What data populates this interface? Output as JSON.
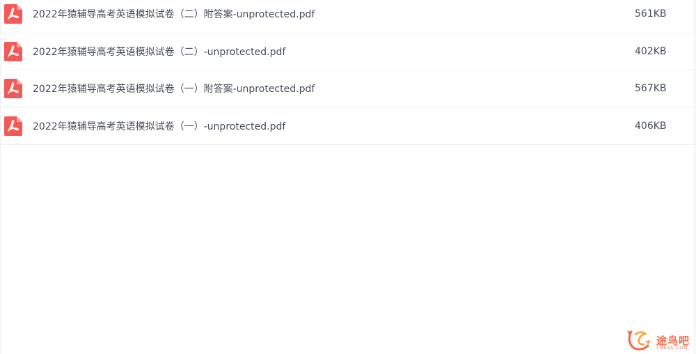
{
  "files": [
    {
      "name": "2022年猿辅导高考英语模拟试卷（二）附答案-unprotected.pdf",
      "size": "561KB",
      "icon": "pdf-icon"
    },
    {
      "name": "2022年猿辅导高考英语模拟试卷（二）-unprotected.pdf",
      "size": "402KB",
      "icon": "pdf-icon"
    },
    {
      "name": "2022年猿辅导高考英语模拟试卷（一）附答案-unprotected.pdf",
      "size": "567KB",
      "icon": "pdf-icon"
    },
    {
      "name": "2022年猿辅导高考英语模拟试卷（一）-unprotected.pdf",
      "size": "406KB",
      "icon": "pdf-icon"
    }
  ],
  "watermark": {
    "text": "途鸟吧",
    "sub": "TNBZS.COM",
    "color": "#f26c4f"
  },
  "colors": {
    "pdf_icon": "#f25a58",
    "text": "#454d5a"
  }
}
